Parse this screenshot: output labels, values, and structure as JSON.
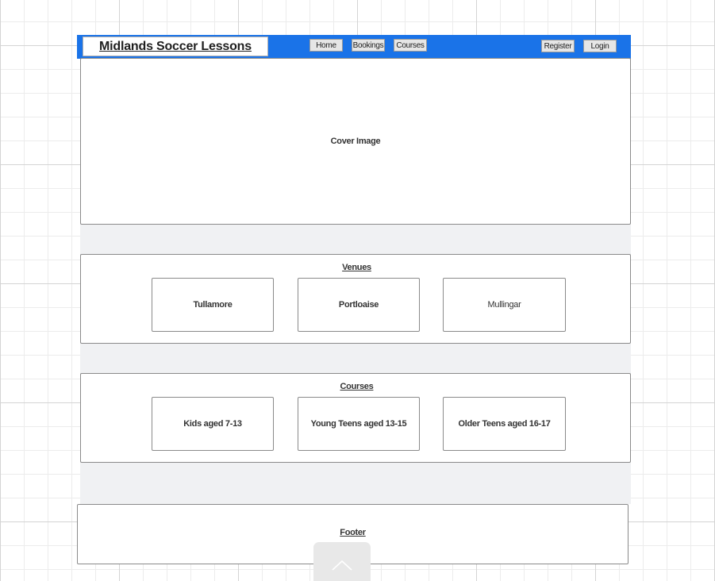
{
  "header": {
    "logo": "Midlands Soccer Lessons",
    "nav": [
      {
        "label": "Home"
      },
      {
        "label": "Bookings"
      },
      {
        "label": "Courses"
      }
    ],
    "register_label": "Register",
    "login_label": "Login"
  },
  "cover": {
    "label": "Cover Image"
  },
  "venues": {
    "title": "Venues",
    "items": [
      {
        "label": "Tullamore"
      },
      {
        "label": "Portloaise"
      },
      {
        "label": "Mullingar"
      }
    ]
  },
  "courses": {
    "title": "Courses",
    "items": [
      {
        "label": "Kids aged 7-13"
      },
      {
        "label": "Young Teens aged 13-15"
      },
      {
        "label": "Older Teens aged 16-17"
      }
    ]
  },
  "footer": {
    "label": "Footer"
  },
  "icons": {
    "scroll_top": "chevron-up-icon"
  },
  "colors": {
    "navbar": "#1a73e8",
    "column": "#f0f1f3"
  }
}
